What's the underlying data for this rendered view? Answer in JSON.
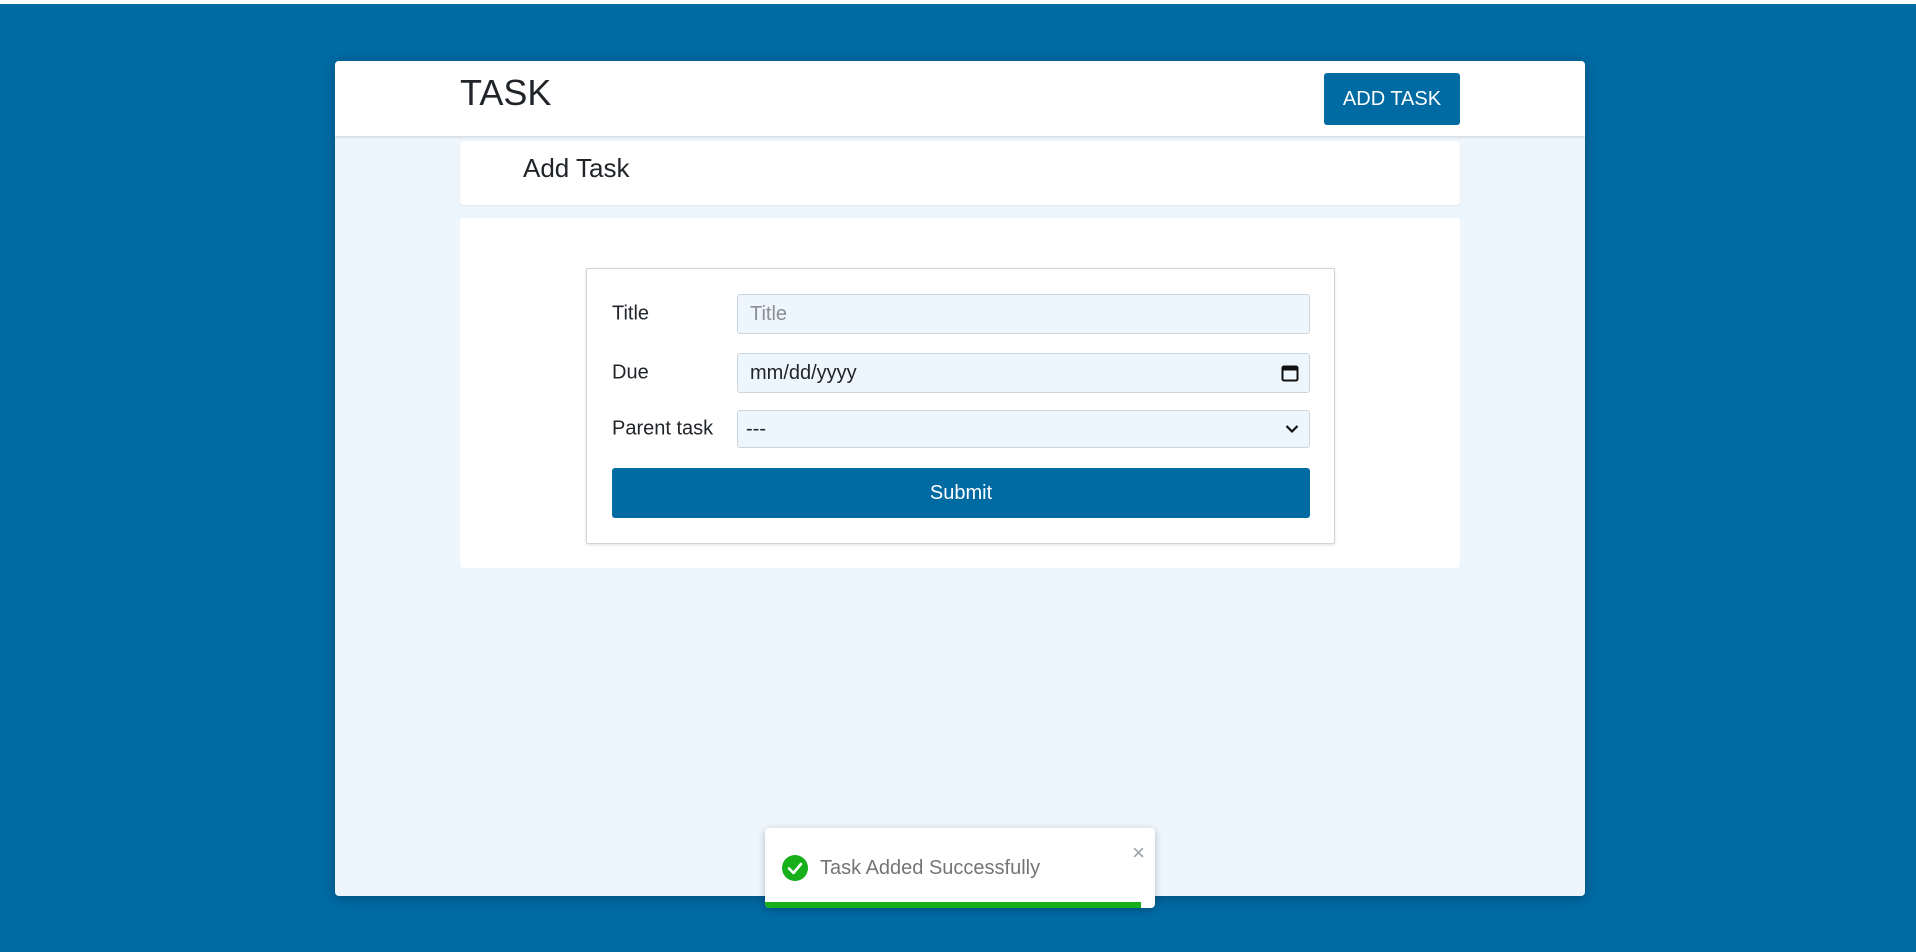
{
  "colors": {
    "background": "#006aa3",
    "primary": "#006aa3",
    "surface": "#eef6fd",
    "success": "#17b01b"
  },
  "header": {
    "brand": "TASK",
    "add_task_label": "ADD TASK"
  },
  "page": {
    "title": "Add Task"
  },
  "form": {
    "title_label": "Title",
    "title_placeholder": "Title",
    "title_value": "",
    "due_label": "Due",
    "due_value": "mm/dd/yyyy",
    "due_icon": "calendar-icon",
    "parent_label": "Parent task",
    "parent_selected": "---",
    "parent_icon": "chevron-down-icon",
    "submit_label": "Submit"
  },
  "toast": {
    "icon": "check-circle-icon",
    "message": "Task Added Successfully",
    "close_symbol": "×",
    "progress": 0.965
  }
}
